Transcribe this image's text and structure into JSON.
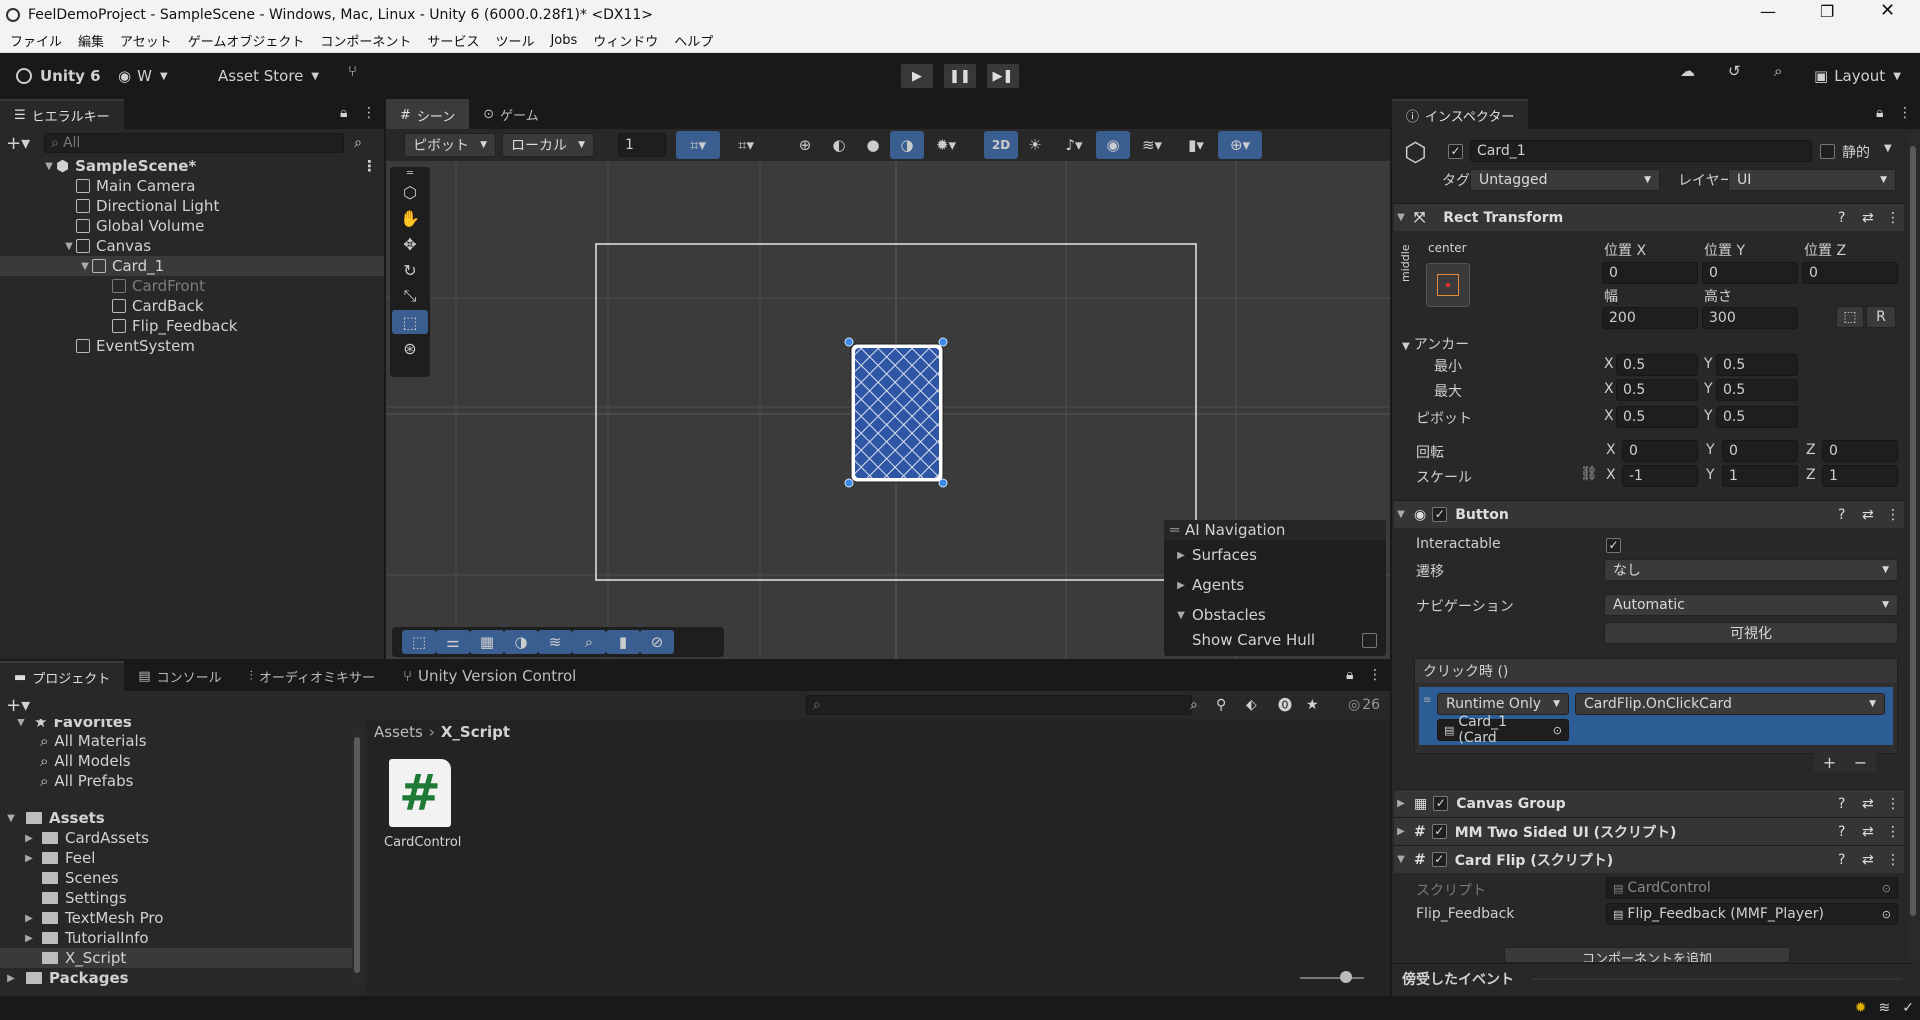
{
  "window": {
    "title": "FeelDemoProject - SampleScene - Windows, Mac, Linux - Unity 6 (6000.0.28f1)* <DX11>"
  },
  "menu": [
    "ファイル",
    "編集",
    "アセット",
    "ゲームオブジェクト",
    "コンポーネント",
    "サービス",
    "ツール",
    "Jobs",
    "ウィンドウ",
    "ヘルプ"
  ],
  "toolbar": {
    "unity_label": "Unity 6",
    "account": "W",
    "asset_store": "Asset Store",
    "layout": "Layout"
  },
  "hierarchy": {
    "tab": "ヒエラルキー",
    "search_placeholder": "All",
    "scene": "SampleScene*",
    "items": [
      "Main Camera",
      "Directional Light",
      "Global Volume",
      "Canvas",
      "Card_1",
      "CardFront",
      "CardBack",
      "Flip_Feedback",
      "EventSystem"
    ]
  },
  "scene_view": {
    "tabs": [
      "シーン",
      "ゲーム"
    ],
    "pivot": "ピボット",
    "local": "ローカル",
    "grid_value": "1",
    "mode_2d": "2D",
    "overlay": {
      "title": "AI Navigation",
      "items": [
        "Surfaces",
        "Agents",
        "Obstacles"
      ],
      "toggle": "Show Carve Hull"
    }
  },
  "project": {
    "tabs": [
      "プロジェクト",
      "コンソール",
      "オーディオミキサー",
      "Unity Version Control"
    ],
    "favorites": {
      "label": "Favorites",
      "items": [
        "All Materials",
        "All Models",
        "All Prefabs"
      ]
    },
    "assets": {
      "label": "Assets",
      "items": [
        "CardAssets",
        "Feel",
        "Scenes",
        "Settings",
        "TextMesh Pro",
        "TutorialInfo",
        "X_Script"
      ]
    },
    "packages": "Packages",
    "breadcrumb": [
      "Assets",
      "X_Script"
    ],
    "file": "CardControl",
    "count": "26"
  },
  "inspector": {
    "tab": "インスペクター",
    "object_name": "Card_1",
    "static": "静的",
    "tag_label": "タグ",
    "tag": "Untagged",
    "layer_label": "レイヤー",
    "layer": "UI",
    "rect": {
      "title": "Rect Transform",
      "anchor_h": "center",
      "anchor_v": "middle",
      "pos_x_label": "位置 X",
      "pos_y_label": "位置 Y",
      "pos_z_label": "位置 Z",
      "pos_x": "0",
      "pos_y": "0",
      "pos_z": "0",
      "width_label": "幅",
      "height_label": "高さ",
      "width": "200",
      "height": "300",
      "anchors": "アンカー",
      "min": "最小",
      "max": "最大",
      "pivot": "ピボット",
      "min_x": "0.5",
      "min_y": "0.5",
      "max_x": "0.5",
      "max_y": "0.5",
      "pivot_x": "0.5",
      "pivot_y": "0.5",
      "rotation": "回転",
      "rot_x": "0",
      "rot_y": "0",
      "rot_z": "0",
      "scale": "スケール",
      "scale_x": "-1",
      "scale_y": "1",
      "scale_z": "1",
      "x": "X",
      "y": "Y",
      "z": "Z"
    },
    "button": {
      "title": "Button",
      "interactable": "Interactable",
      "transition_label": "遷移",
      "transition": "なし",
      "navigation_label": "ナビゲーション",
      "navigation": "Automatic",
      "visualize": "可視化",
      "onclick": "クリック時 ()",
      "runtime": "Runtime Only",
      "function": "CardFlip.OnClickCard",
      "target": "Card_1 (Card"
    },
    "components": [
      "Canvas Group",
      "MM Two Sided UI (スクリプト)",
      "Card Flip (スクリプト)"
    ],
    "cardflip": {
      "script_label": "スクリプト",
      "script": "CardControl",
      "feedback_label": "Flip_Feedback",
      "feedback": "Flip_Feedback (MMF_Player)"
    },
    "add_component": "コンポーネントを追加",
    "events": "傍受したイベント"
  }
}
